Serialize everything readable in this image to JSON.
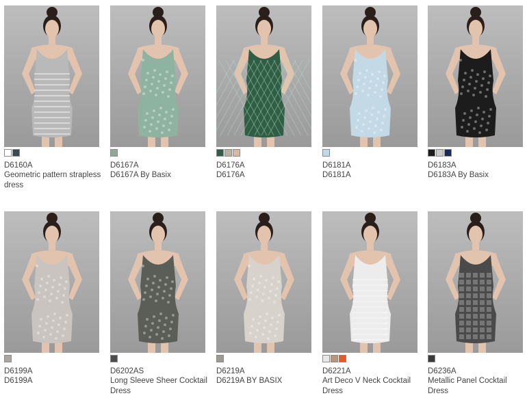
{
  "products": [
    {
      "code": "D6160A",
      "name": "Geometric pattern strapless dress",
      "dress_color": "#b9b9b9",
      "pattern": "stripes",
      "swatches": [
        "#ffffff",
        "#3a4a52"
      ]
    },
    {
      "code": "D6167A",
      "name": "D6167A By Basix",
      "dress_color": "#8fb3a1",
      "pattern": "lace",
      "swatches": [
        "#8fa89a"
      ]
    },
    {
      "code": "D6176A",
      "name": "D6176A",
      "dress_color": "#2f5e45",
      "pattern": "diamond",
      "swatches": [
        "#2f5e45",
        "#b9b0a4",
        "#d7b9a0"
      ]
    },
    {
      "code": "D6181A",
      "name": "D6181A",
      "dress_color": "#c4d9e6",
      "pattern": "lace",
      "swatches": [
        "#c4d9e6"
      ]
    },
    {
      "code": "D6183A",
      "name": "D6183A By Basix",
      "dress_color": "#1c1c1c",
      "pattern": "lace",
      "swatches": [
        "#1c1c1c",
        "#c9c9c9",
        "#1d2a55"
      ]
    },
    {
      "code": "D6199A",
      "name": "D6199A",
      "dress_color": "#c9c4c0",
      "pattern": "lace",
      "swatches": [
        "#a9a6a4"
      ]
    },
    {
      "code": "D6202AS",
      "name": "Long Sleeve Sheer Cocktail Dress",
      "dress_color": "#5a5e57",
      "pattern": "lace",
      "swatches": [
        "#4d4d4d"
      ]
    },
    {
      "code": "D6219A",
      "name": "D6219A BY BASIX",
      "dress_color": "#d7d3cc",
      "pattern": "lace",
      "swatches": [
        "#9c9a93"
      ]
    },
    {
      "code": "D6221A",
      "name": "Art Deco V Neck Cocktail Dress",
      "dress_color": "#ececec",
      "pattern": "stripes",
      "swatches": [
        "#e8e8e8",
        "#b8977c",
        "#e35a2c"
      ]
    },
    {
      "code": "D6236A",
      "name": "Metallic Panel Cocktail Dress",
      "dress_color": "#4a4a4a",
      "pattern": "panel",
      "swatches": [
        "#3a3a3a"
      ]
    }
  ]
}
